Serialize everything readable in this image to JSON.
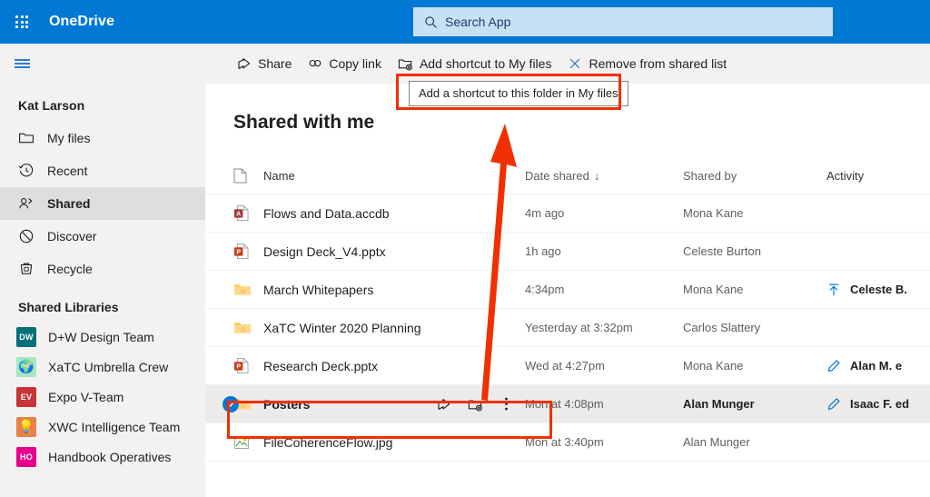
{
  "suite": {
    "waffle_label": "app-launcher",
    "title": "OneDrive",
    "search": {
      "placeholder": "Search App",
      "value": ""
    }
  },
  "commandbar": {
    "items": [
      {
        "label": "Share",
        "icon": "share-icon"
      },
      {
        "label": "Copy link",
        "icon": "link-icon"
      },
      {
        "label": "Add shortcut to My files",
        "icon": "add-shortcut-icon"
      },
      {
        "label": "Remove from shared list",
        "icon": "close-icon"
      }
    ]
  },
  "tooltip": {
    "text": "Add a shortcut to this folder in My files"
  },
  "sidebar": {
    "owner": "Kat Larson",
    "items": [
      {
        "label": "My files",
        "icon": "folder-icon",
        "selected": false
      },
      {
        "label": "Recent",
        "icon": "clock-icon",
        "selected": false
      },
      {
        "label": "Shared",
        "icon": "people-icon",
        "selected": true
      },
      {
        "label": "Discover",
        "icon": "discover-icon",
        "selected": false
      },
      {
        "label": "Recycle",
        "icon": "trash-icon",
        "selected": false
      }
    ],
    "libraries_heading": "Shared Libraries",
    "libraries": [
      {
        "label": "D+W Design Team",
        "initials": "DW",
        "color": "#017078",
        "glyph": ""
      },
      {
        "label": "XaTC Umbrella Crew",
        "initials": "",
        "color": "#a8e6c0",
        "glyph": "🌍"
      },
      {
        "label": "Expo V-Team",
        "initials": "EV",
        "color": "#c6343a",
        "glyph": ""
      },
      {
        "label": "XWC Intelligence Team",
        "initials": "",
        "color": "#e8814a",
        "glyph": "💡"
      },
      {
        "label": "Handbook Operatives",
        "initials": "HO",
        "color": "#e8008c",
        "glyph": ""
      }
    ]
  },
  "main": {
    "page_title": "Shared with me",
    "columns": [
      {
        "label": "Name",
        "sorted": false
      },
      {
        "label": "Date shared",
        "sorted": true,
        "sort_glyph": "↓"
      },
      {
        "label": "Shared by",
        "sorted": false
      },
      {
        "label": "Activity",
        "sorted": false
      }
    ],
    "rows": [
      {
        "name": "Flows and Data.accdb",
        "icon": "access-file-icon",
        "date_shared": "4m ago",
        "shared_by": "Mona Kane",
        "activity_text": "",
        "activity_icon": "",
        "selected": false
      },
      {
        "name": "Design Deck_V4.pptx",
        "icon": "powerpoint-file-icon",
        "date_shared": "1h ago",
        "shared_by": "Celeste Burton",
        "activity_text": "",
        "activity_icon": "",
        "selected": false
      },
      {
        "name": "March Whitepapers",
        "icon": "shared-folder-icon",
        "date_shared": "4:34pm",
        "shared_by": "Mona Kane",
        "activity_text": "Celeste B.",
        "activity_icon": "upload-icon",
        "selected": false
      },
      {
        "name": "XaTC Winter 2020 Planning",
        "icon": "shared-folder-icon",
        "date_shared": "Yesterday at 3:32pm",
        "shared_by": "Carlos Slattery",
        "activity_text": "",
        "activity_icon": "",
        "selected": false
      },
      {
        "name": "Research Deck.pptx",
        "icon": "powerpoint-file-icon",
        "date_shared": "Wed at 4:27pm",
        "shared_by": "Mona Kane",
        "activity_text": "Alan M. e",
        "activity_icon": "edit-icon",
        "selected": false
      },
      {
        "name": "Posters",
        "icon": "shared-folder-icon",
        "date_shared": "Mon at 4:08pm",
        "shared_by": "Alan Munger",
        "activity_text": "Isaac F. ed",
        "activity_icon": "edit-icon",
        "selected": true,
        "actions": [
          {
            "name": "share-icon"
          },
          {
            "name": "add-shortcut-icon"
          },
          {
            "name": "more-options-icon"
          }
        ]
      },
      {
        "name": "FileCoherenceFlow.jpg",
        "icon": "image-file-icon",
        "date_shared": "Mon at 3:40pm",
        "shared_by": "Alan Munger",
        "activity_text": "",
        "activity_icon": "",
        "selected": false
      }
    ]
  },
  "colors": {
    "brand_blue": "#0078d4",
    "annotation_red": "#f03000",
    "search_field": "#c7e0f4",
    "chrome_gray": "#f3f2f1",
    "selected_row": "#edebe9"
  }
}
